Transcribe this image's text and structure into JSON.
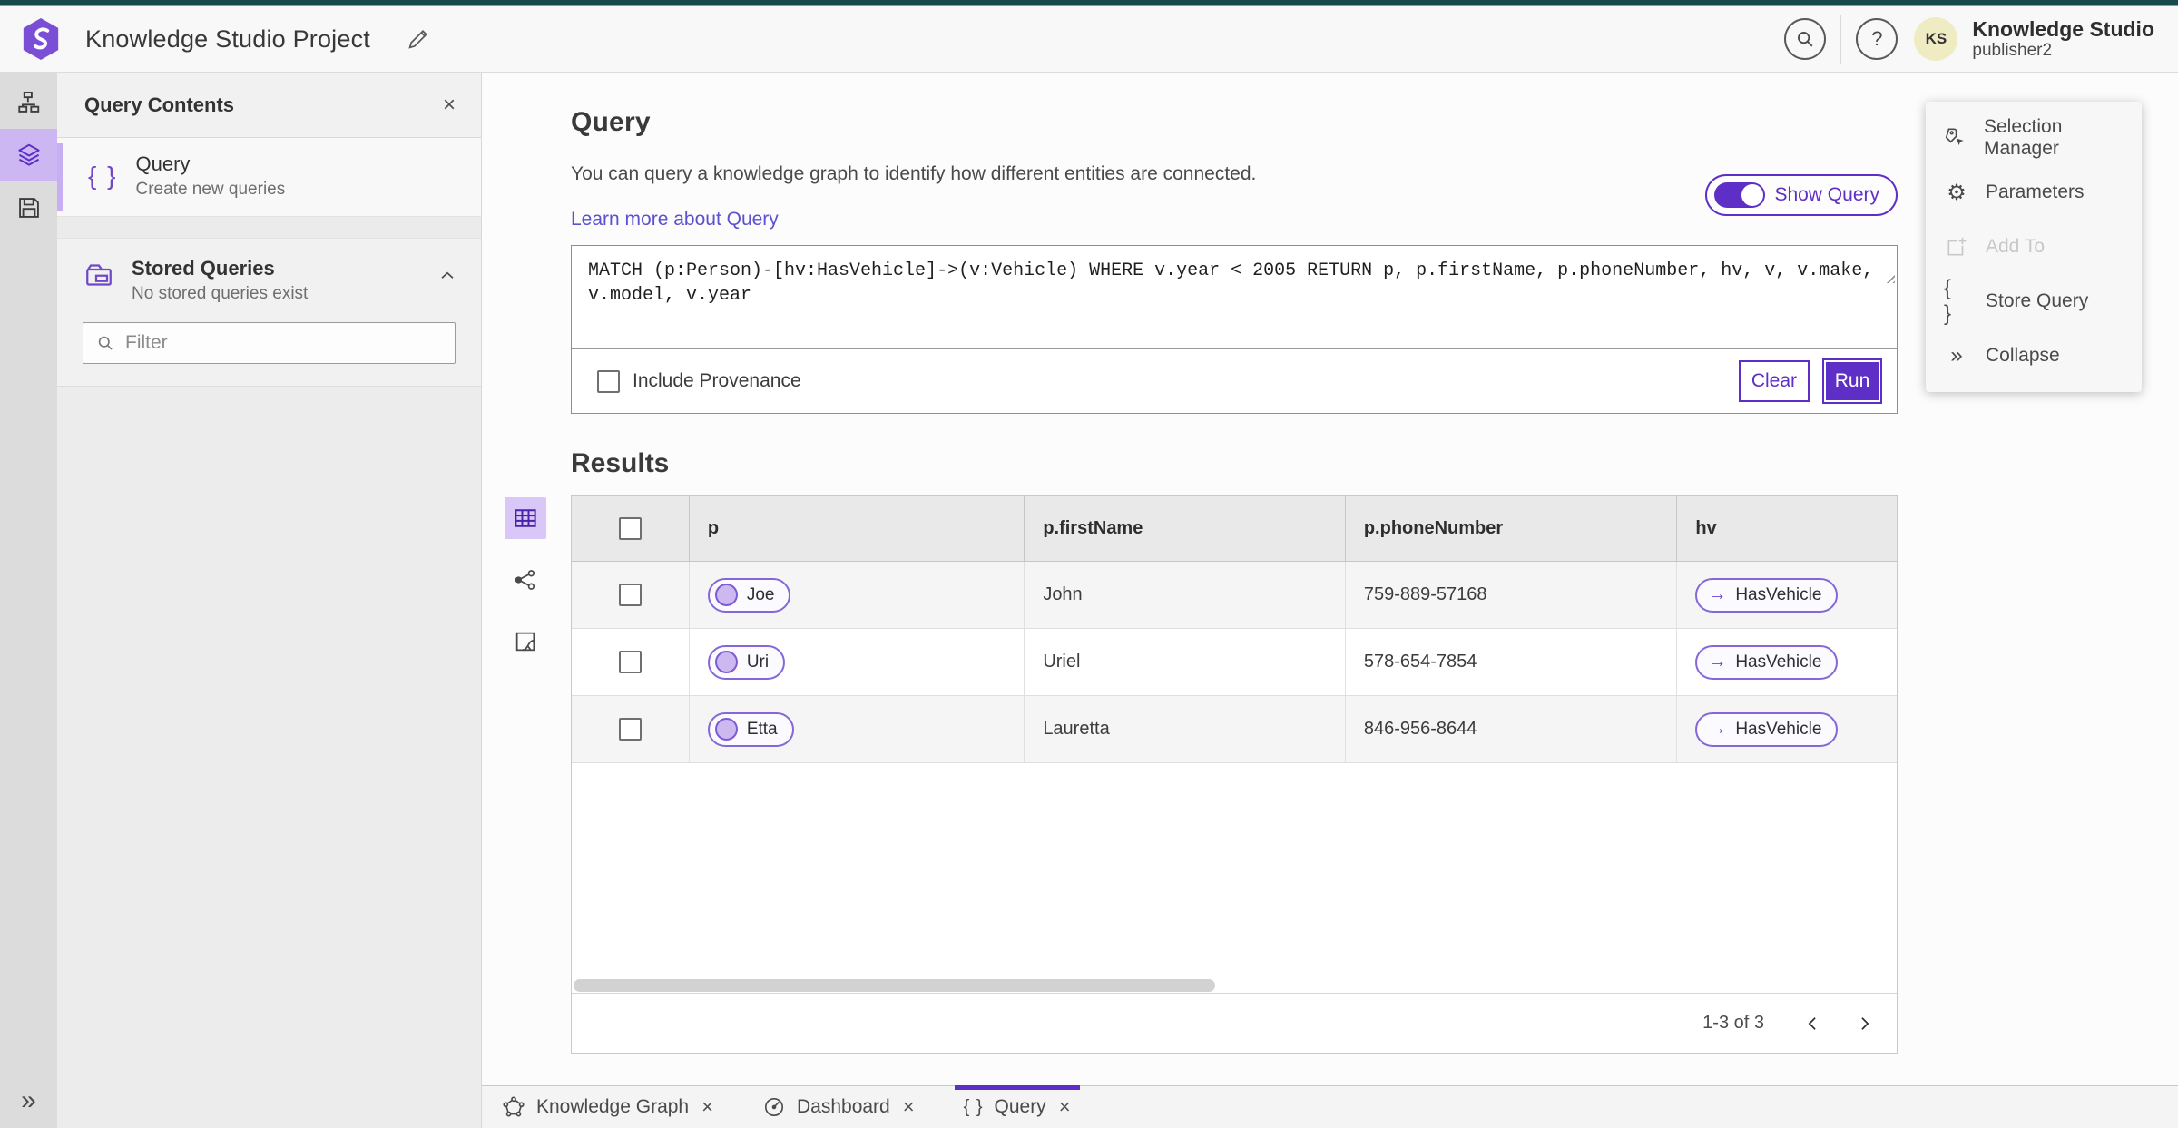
{
  "header": {
    "title": "Knowledge Studio Project",
    "account_name": "Knowledge Studio",
    "account_user": "publisher2",
    "avatar_initials": "KS"
  },
  "left_panel": {
    "title": "Query Contents",
    "query_item": {
      "label": "Query",
      "description": "Create new queries"
    },
    "stored_queries": {
      "label": "Stored Queries",
      "description": "No stored queries exist"
    },
    "filter_placeholder": "Filter"
  },
  "query_section": {
    "title": "Query",
    "description": "You can query a knowledge graph to identify how different entities are connected.",
    "learn_more": "Learn more about Query",
    "show_query_label": "Show Query",
    "query_text": "MATCH (p:Person)-[hv:HasVehicle]->(v:Vehicle) WHERE v.year < 2005 RETURN p, p.firstName, p.phoneNumber, hv, v, v.make, v.model, v.year",
    "include_provenance_label": "Include Provenance",
    "clear_label": "Clear",
    "run_label": "Run"
  },
  "results": {
    "title": "Results",
    "columns": [
      "p",
      "p.firstName",
      "p.phoneNumber",
      "hv"
    ],
    "rows": [
      {
        "p": "Joe",
        "firstName": "John",
        "phoneNumber": "759-889-57168",
        "hv": "HasVehicle"
      },
      {
        "p": "Uri",
        "firstName": "Uriel",
        "phoneNumber": "578-654-7854",
        "hv": "HasVehicle"
      },
      {
        "p": "Etta",
        "firstName": "Lauretta",
        "phoneNumber": "846-956-8644",
        "hv": "HasVehicle"
      }
    ],
    "pagination": "1-3 of 3"
  },
  "right_panel": {
    "items": [
      {
        "label": "Selection Manager",
        "disabled": false
      },
      {
        "label": "Parameters",
        "disabled": false
      },
      {
        "label": "Add To",
        "disabled": true
      },
      {
        "label": "Store Query",
        "disabled": false
      },
      {
        "label": "Collapse",
        "disabled": false
      }
    ]
  },
  "bottom_tabs": [
    {
      "label": "Knowledge Graph",
      "active": false
    },
    {
      "label": "Dashboard",
      "active": false
    },
    {
      "label": "Query",
      "active": true
    }
  ],
  "glyphs": {
    "close": "×",
    "help": "?",
    "braces": "{ }",
    "arrow_right": "→",
    "double_chevron": "»",
    "gear": "⚙"
  },
  "colors": {
    "accent_purple": "#5e2fc7",
    "accent_light": "#cdb7f3",
    "link": "#5a50d0",
    "chip_border": "#8468d8",
    "top_strip": "#164a4d",
    "top_strip_light": "#7aa3a4",
    "avatar_bg": "#efecc4"
  }
}
